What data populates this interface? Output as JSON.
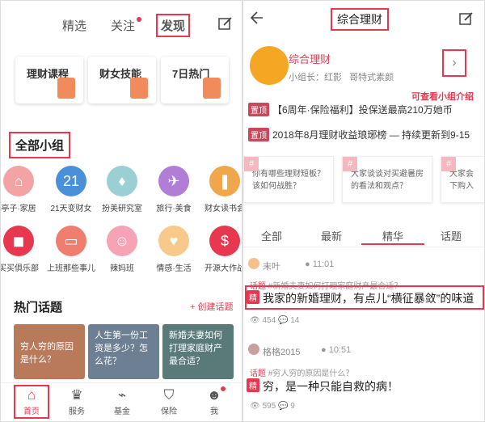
{
  "left": {
    "tabs": [
      "精选",
      "关注",
      "发现"
    ],
    "quick_cards": [
      "理财课程",
      "财女技能",
      "7日热门"
    ],
    "groups_title": "全部小组",
    "groups_row1": [
      "亭子·家居",
      "21天变财女",
      "扮美研究室",
      "旅行·美食",
      "财女读书会"
    ],
    "groups_row2": [
      "买买俱乐部",
      "上班那些事儿",
      "辣妈班",
      "情感·生活",
      "开源大作战"
    ],
    "hot_title": "热门话题",
    "create_topic": "+ 创建话题",
    "hot_cards": [
      "穷人穷的原因是什么？",
      "人生第一份工资是多少？怎么花？",
      "新婚夫妻如何打理家庭财产最合适？"
    ],
    "bottom": [
      "首页",
      "服务",
      "基金",
      "保险",
      "我"
    ]
  },
  "right": {
    "title": "综合理财",
    "group_name": "综合理财",
    "group_leader": "小组长：红影   哥特式素颜",
    "annotation": "可查看小组介绍",
    "pin_label": "置顶",
    "pins": [
      "【6周年·保险福利】投保送最高210万她币",
      "2018年8月理财收益琅琊榜 — 持续更新到9-15"
    ],
    "topics": [
      "你有哪些理财短板？该如何战胜？",
      "大家谈谈对买避暑房的看法和观点？",
      "大家会下购入"
    ],
    "tabs": [
      "全部",
      "最新",
      "精华",
      "话题"
    ],
    "post1": {
      "user": "末叶",
      "time": "11:01",
      "tag": "话题",
      "hashtag": "#新婚夫妻如何打理家庭财产最合适？",
      "jing": "精",
      "title": "我家的新婚理财，有点儿“横征暴敛”的味道",
      "views": "454",
      "comments": "14"
    },
    "post2": {
      "user": "格格2015",
      "time": "10:51",
      "tag": "话题",
      "hashtag": "#穷人穷的原因是什么？",
      "jing": "精",
      "title": "穷，是一种只能自救的病！",
      "views": "595",
      "comments": "9"
    }
  }
}
